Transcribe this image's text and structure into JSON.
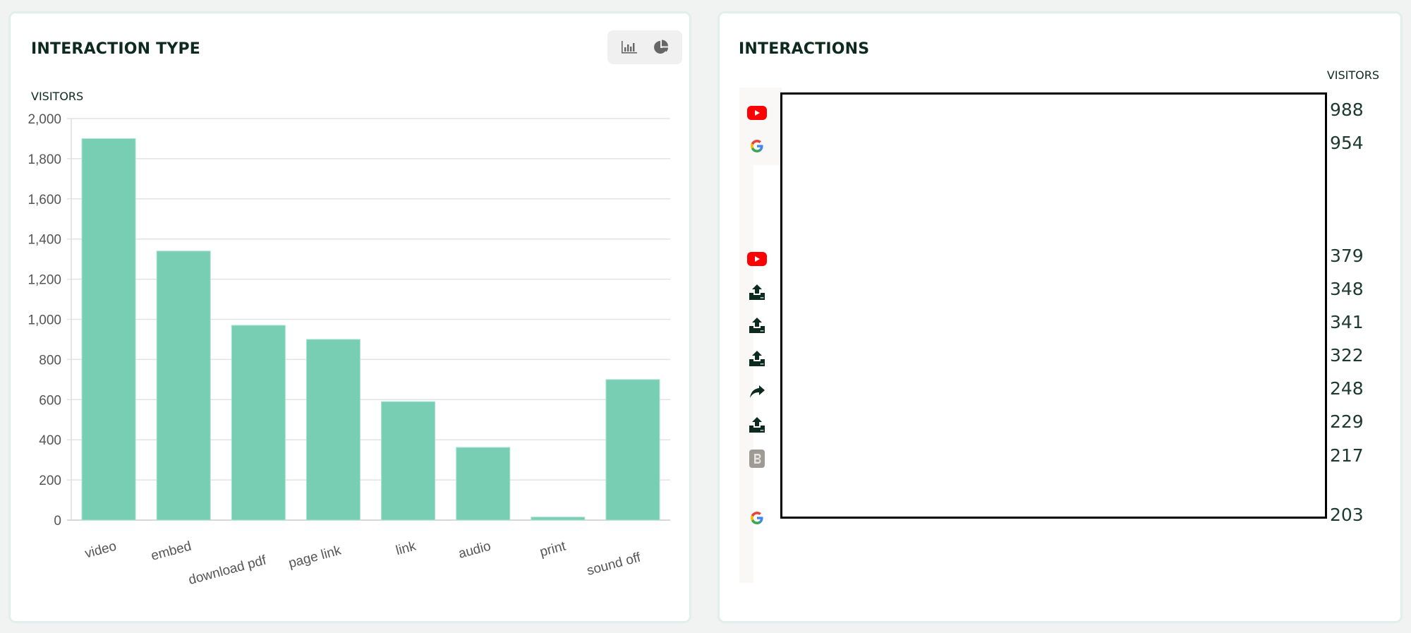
{
  "left_panel": {
    "title": "INTERACTION TYPE",
    "view_toggle": {
      "bar_icon": "bar-chart-icon",
      "pie_icon": "pie-chart-icon",
      "active": "bar"
    },
    "y_axis_title": "VISITORS"
  },
  "chart_data": {
    "type": "bar",
    "title": "INTERACTION TYPE",
    "xlabel": "",
    "ylabel": "VISITORS",
    "categories": [
      "video",
      "embed",
      "download pdf",
      "page link",
      "link",
      "audio",
      "print",
      "sound off"
    ],
    "values": [
      1900,
      1340,
      970,
      900,
      590,
      362,
      15,
      700
    ],
    "ylim": [
      0,
      2000
    ],
    "yticks": [
      0,
      200,
      400,
      600,
      800,
      1000,
      1200,
      1400,
      1600,
      1800,
      2000
    ],
    "ytick_labels": [
      "0",
      "200",
      "400",
      "600",
      "800",
      "1,000",
      "1,200",
      "1,400",
      "1,600",
      "1,800",
      "2,000"
    ],
    "grid": true,
    "legend": "none",
    "bar_color": "#74cdb0"
  },
  "right_panel": {
    "title": "INTERACTIONS",
    "column_header": "VISITORS",
    "rows": [
      {
        "icon": "youtube-icon",
        "value": "988"
      },
      {
        "icon": "google-icon",
        "value": "954"
      },
      {
        "icon": "youtube-icon",
        "value": "379"
      },
      {
        "icon": "upload-icon",
        "value": "348"
      },
      {
        "icon": "upload-icon",
        "value": "341"
      },
      {
        "icon": "upload-icon",
        "value": "322"
      },
      {
        "icon": "share-icon",
        "value": "248"
      },
      {
        "icon": "upload-icon",
        "value": "229"
      },
      {
        "icon": "bootstrap-icon",
        "value": "217"
      },
      {
        "icon": "google-icon",
        "value": "203"
      }
    ]
  }
}
